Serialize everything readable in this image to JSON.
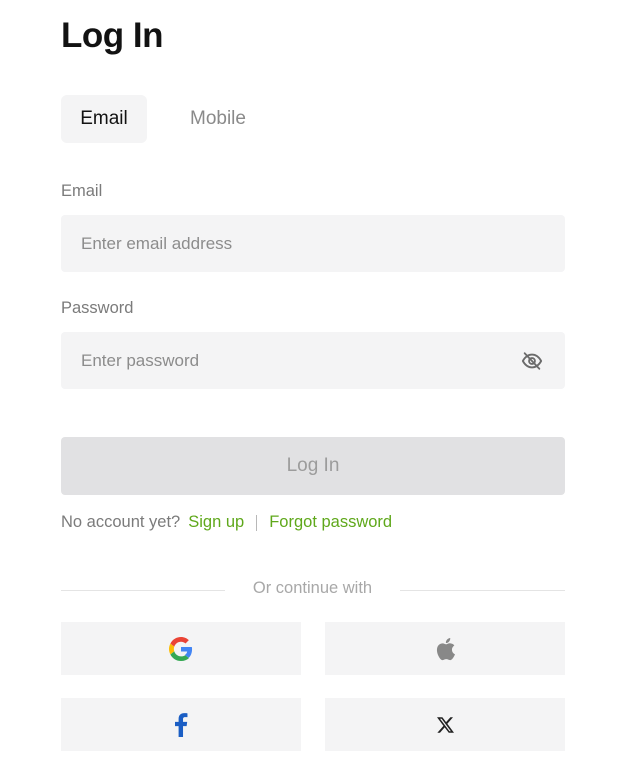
{
  "page": {
    "title": "Log In"
  },
  "tabs": [
    {
      "label": "Email",
      "active": true
    },
    {
      "label": "Mobile",
      "active": false
    }
  ],
  "email": {
    "label": "Email",
    "placeholder": "Enter email address",
    "value": ""
  },
  "password": {
    "label": "Password",
    "placeholder": "Enter password",
    "value": "",
    "toggle_icon": "eye-slash-icon"
  },
  "login_button": {
    "label": "Log In",
    "enabled": false
  },
  "account_links": {
    "prompt": "No account yet?",
    "signup": "Sign up",
    "forgot": "Forgot password"
  },
  "divider": {
    "text": "Or continue with"
  },
  "social": [
    {
      "provider": "google",
      "icon": "google-icon"
    },
    {
      "provider": "apple",
      "icon": "apple-icon"
    },
    {
      "provider": "facebook",
      "icon": "facebook-icon"
    },
    {
      "provider": "x",
      "icon": "x-icon"
    }
  ],
  "colors": {
    "accent_green": "#5fa81b",
    "input_bg": "#f4f4f5",
    "disabled_button_bg": "#e1e1e3",
    "facebook_blue": "#1b5ec4"
  }
}
